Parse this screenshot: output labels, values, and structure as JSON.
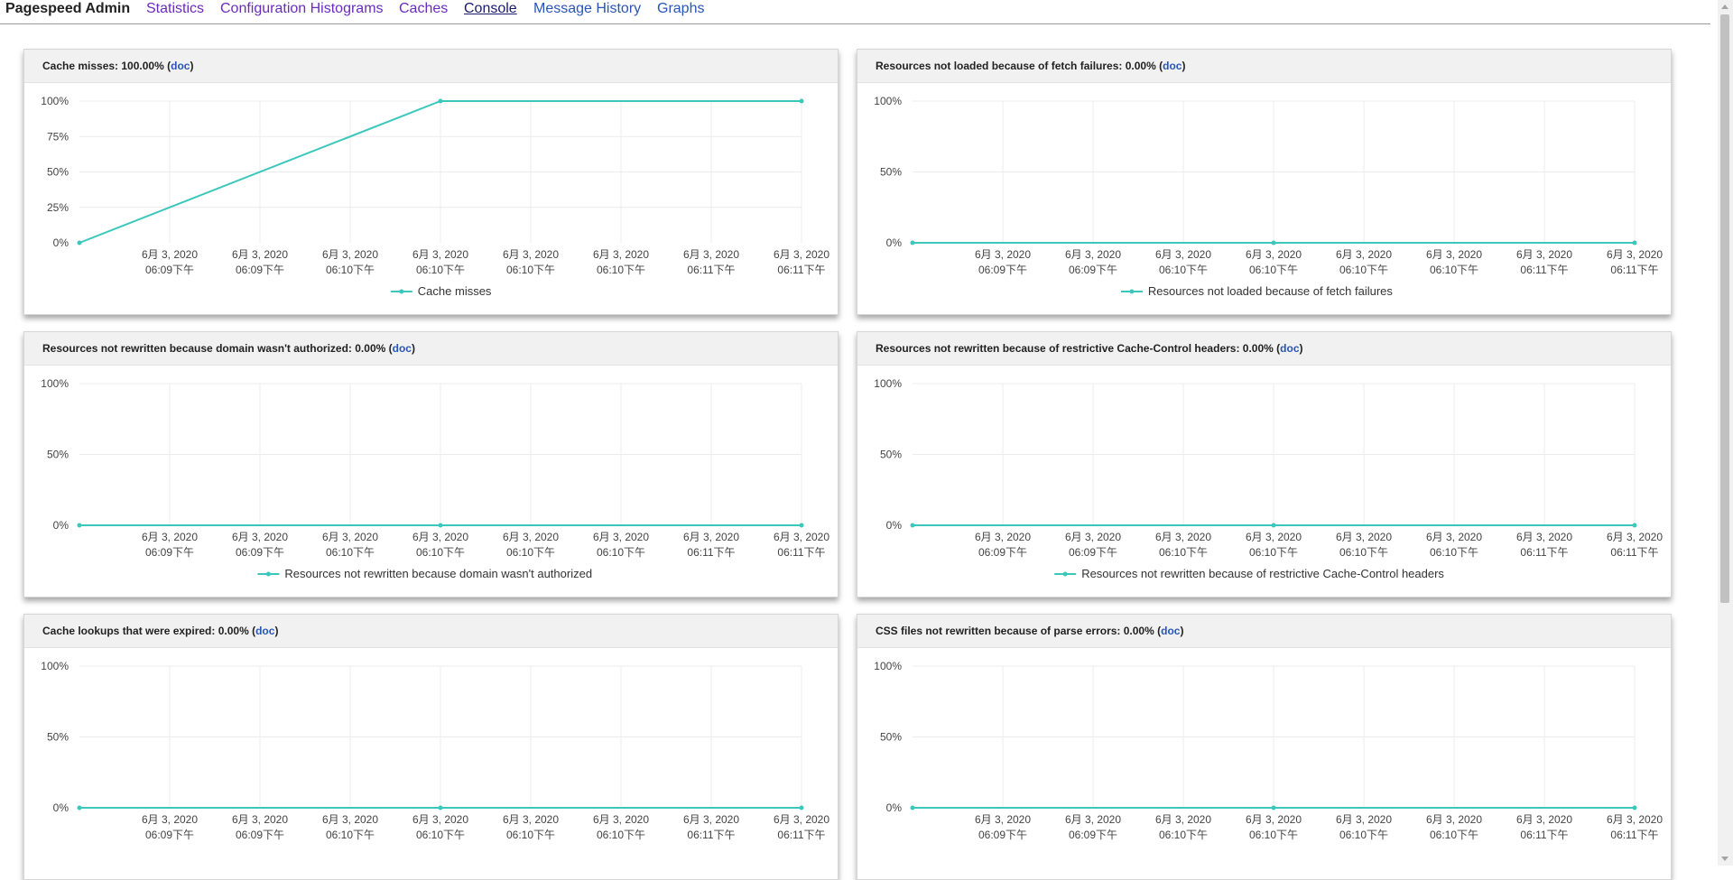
{
  "nav": {
    "brand": "Pagespeed Admin",
    "links": [
      "Statistics",
      "Configuration Histograms",
      "Caches",
      "Console",
      "Message History",
      "Graphs"
    ]
  },
  "colors": {
    "series": "#3cc7bd",
    "grid": "#ececec",
    "link": "#2a55b8"
  },
  "x_dates": [
    "6月 3, 2020",
    "6月 3, 2020",
    "6月 3, 2020",
    "6月 3, 2020",
    "6月 3, 2020",
    "6月 3, 2020",
    "6月 3, 2020",
    "6月 3, 2020"
  ],
  "x_times": [
    "06:09下午",
    "06:09下午",
    "06:10下午",
    "06:10下午",
    "06:10下午",
    "06:10下午",
    "06:11下午",
    "06:11下午"
  ],
  "cards": [
    {
      "title": "Cache misses: 100.00%",
      "doc": "doc"
    },
    {
      "title": "Resources not loaded because of fetch failures: 0.00%",
      "doc": "doc"
    },
    {
      "title": "Resources not rewritten because domain wasn't authorized: 0.00%",
      "doc": "doc"
    },
    {
      "title": "Resources not rewritten because of restrictive Cache-Control headers: 0.00%",
      "doc": "doc"
    },
    {
      "title": "Cache lookups that were expired: 0.00%",
      "doc": "doc"
    },
    {
      "title": "CSS files not rewritten because of parse errors: 0.00%",
      "doc": "doc"
    }
  ],
  "chart_data": [
    {
      "type": "line",
      "legend": "Cache misses",
      "yticks": [
        "0%",
        "25%",
        "50%",
        "75%",
        "100%"
      ],
      "ylim": [
        0,
        100
      ],
      "x": [
        0,
        4,
        8
      ],
      "values": [
        0,
        100,
        100
      ]
    },
    {
      "type": "line",
      "legend": "Resources not loaded because of fetch failures",
      "yticks": [
        "0%",
        "50%",
        "100%"
      ],
      "ylim": [
        0,
        100
      ],
      "x": [
        0,
        4,
        8
      ],
      "values": [
        0,
        0,
        0
      ]
    },
    {
      "type": "line",
      "legend": "Resources not rewritten because domain wasn't authorized",
      "yticks": [
        "0%",
        "50%",
        "100%"
      ],
      "ylim": [
        0,
        100
      ],
      "x": [
        0,
        4,
        8
      ],
      "values": [
        0,
        0,
        0
      ]
    },
    {
      "type": "line",
      "legend": "Resources not rewritten because of restrictive Cache-Control headers",
      "yticks": [
        "0%",
        "50%",
        "100%"
      ],
      "ylim": [
        0,
        100
      ],
      "x": [
        0,
        4,
        8
      ],
      "values": [
        0,
        0,
        0
      ]
    },
    {
      "type": "line",
      "legend": "",
      "yticks": [
        "0%",
        "50%",
        "100%"
      ],
      "ylim": [
        0,
        100
      ],
      "x": [
        0,
        4,
        8
      ],
      "values": [
        0,
        0,
        0
      ]
    },
    {
      "type": "line",
      "legend": "",
      "yticks": [
        "0%",
        "50%",
        "100%"
      ],
      "ylim": [
        0,
        100
      ],
      "x": [
        0,
        4,
        8
      ],
      "values": [
        0,
        0,
        0
      ]
    }
  ]
}
